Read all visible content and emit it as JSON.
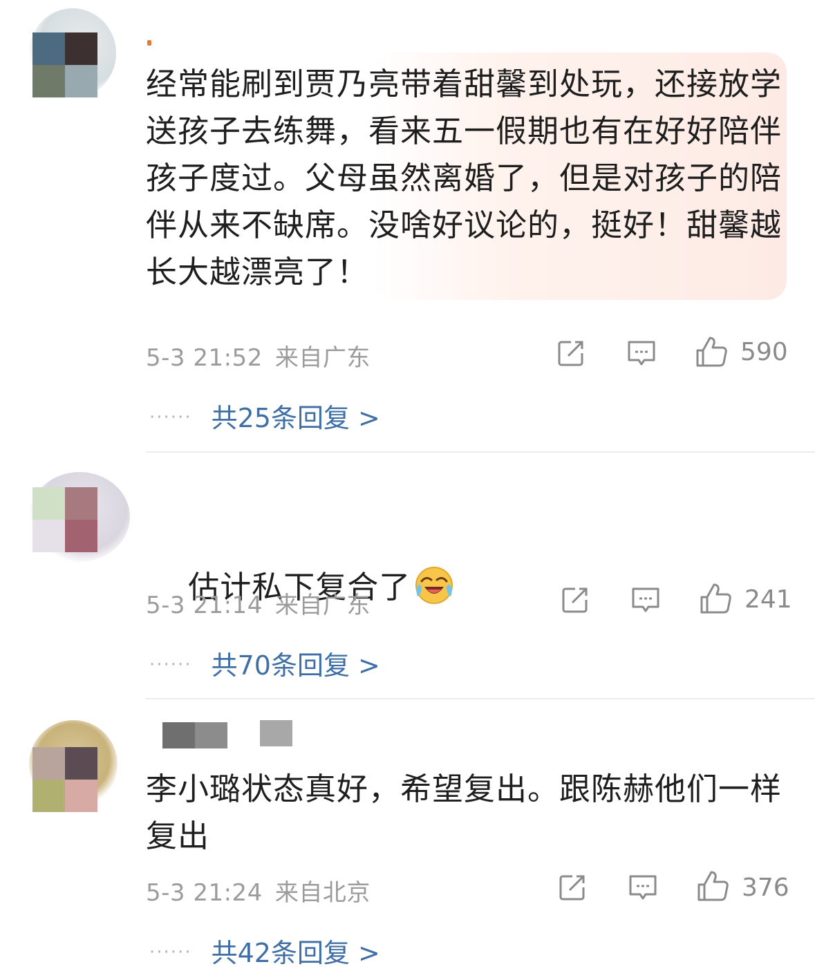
{
  "comments": [
    {
      "text": "经常能刷到贾乃亮带着甜馨到处玩，还接放学送孩子去练舞，看来五一假期也有在好好陪伴孩子度过。父母虽然离婚了，但是对孩子的陪伴从来不缺席。没啥好议论的，挺好！甜馨越长大越漂亮了！",
      "time": "5-3 21:52",
      "location": "来自广东",
      "likes": "590",
      "replies": "共25条回复 >",
      "replies_dots": "······",
      "avatar_colors": [
        "#4c6a80",
        "#3d3030",
        "#707a68",
        "#98a9b0"
      ]
    },
    {
      "text": "估计私下复合了",
      "emoji": "laugh-cry-emoji",
      "time": "5-3 21:14",
      "location": "来自广东",
      "likes": "241",
      "replies": "共70条回复 >",
      "replies_dots": "······",
      "avatar_colors": [
        "#cfe0c6",
        "#a77a80",
        "#e6e0e8",
        "#a36270"
      ]
    },
    {
      "text": "李小璐状态真好，希望复出。跟陈赫他们一样复出",
      "time": "5-3 21:24",
      "location": "来自北京",
      "likes": "376",
      "replies": "共42条回复 >",
      "replies_dots": "······",
      "avatar_colors": [
        "#b8a49a",
        "#5a4c52",
        "#b0b070",
        "#d8aaa4"
      ]
    }
  ],
  "icons": {
    "share": "share-icon",
    "comment": "comment-icon",
    "like": "thumbs-up-icon"
  },
  "colors": {
    "link": "#3f6fa6",
    "meta": "#9b9b9b",
    "text": "#1e1e1e"
  }
}
